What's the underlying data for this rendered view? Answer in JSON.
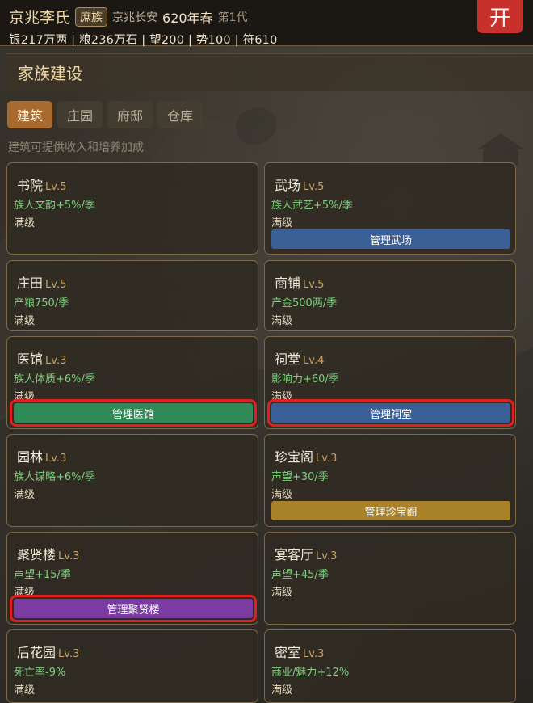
{
  "header": {
    "clan_name": "京兆李氏",
    "clan_tag": "庶族",
    "location": "京兆长安",
    "season": "620年春",
    "generation": "第1代",
    "stats": "银217万两 | 粮236万石 | 望200 | 势100 | 符610",
    "open_button": "开"
  },
  "section": {
    "title": "家族建设"
  },
  "tabs": [
    {
      "label": "建筑",
      "active": true
    },
    {
      "label": "庄园",
      "active": false
    },
    {
      "label": "府邸",
      "active": false
    },
    {
      "label": "仓库",
      "active": false
    }
  ],
  "hint": "建筑可提供收入和培养加成",
  "buildings": [
    {
      "name": "书院",
      "level": "Lv.5",
      "effect": "族人文韵+5%/季",
      "status": "满级"
    },
    {
      "name": "武场",
      "level": "Lv.5",
      "effect": "族人武艺+5%/季",
      "status": "满级",
      "manage": "管理武场",
      "color": "#3a5f96"
    },
    {
      "name": "庄田",
      "level": "Lv.5",
      "effect": "产粮750/季",
      "status": "满级"
    },
    {
      "name": "商铺",
      "level": "Lv.5",
      "effect": "产金500两/季",
      "status": "满级"
    },
    {
      "name": "医馆",
      "level": "Lv.3",
      "effect": "族人体质+6%/季",
      "status": "满级",
      "manage": "管理医馆",
      "color": "#2f8a57"
    },
    {
      "name": "祠堂",
      "level": "Lv.4",
      "effect": "影响力+60/季",
      "status": "满级",
      "manage": "管理祠堂",
      "color": "#3a5f96"
    },
    {
      "name": "园林",
      "level": "Lv.3",
      "effect": "族人谋略+6%/季",
      "status": "满级"
    },
    {
      "name": "珍宝阁",
      "level": "Lv.3",
      "effect": "声望+30/季",
      "status": "满级",
      "manage": "管理珍宝阁",
      "color": "#a98128"
    },
    {
      "name": "聚贤楼",
      "level": "Lv.3",
      "effect": "声望+15/季",
      "status": "满级",
      "manage": "管理聚贤楼",
      "color": "#7a3ca0"
    },
    {
      "name": "宴客厅",
      "level": "Lv.3",
      "effect": "声望+45/季",
      "status": "满级"
    },
    {
      "name": "后花园",
      "level": "Lv.3",
      "effect": "死亡率-9%",
      "status": "满级"
    },
    {
      "name": "密室",
      "level": "Lv.3",
      "effect": "商业/魅力+12%",
      "status": "满级"
    }
  ]
}
